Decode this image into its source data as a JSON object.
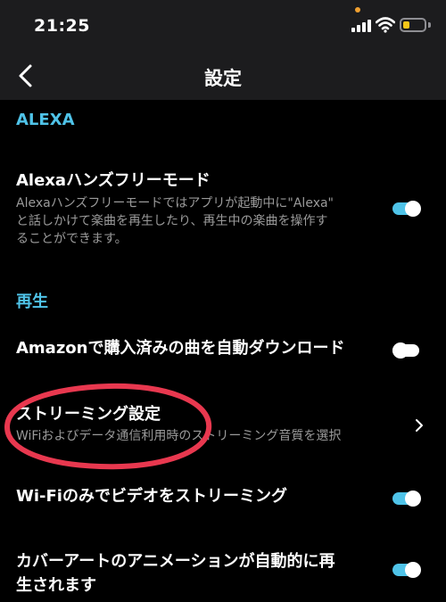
{
  "status_bar": {
    "time": "21:25",
    "icons": [
      "signal-icon",
      "wifi-icon",
      "battery-icon"
    ],
    "battery_level": 0.3
  },
  "nav": {
    "title": "設定",
    "back_icon": "chevron-left-icon"
  },
  "sections": {
    "alexa": {
      "header": "ALEXA",
      "handsfree": {
        "title": "Alexaハンズフリーモード",
        "subtitle_lines": [
          "Alexaハンズフリーモードではアプリが起動中に\"Alexa\"",
          "と話しかけて楽曲を再生したり、再生中の楽曲を操作す",
          "ることができます。"
        ],
        "enabled": true
      }
    },
    "playback": {
      "header": "再生",
      "auto_download": {
        "title": "Amazonで購入済みの曲を自動ダウンロード",
        "enabled": false
      },
      "streaming": {
        "title": "ストリーミング設定",
        "subtitle": "WiFiおよびデータ通信利用時のストリーミング音質を選択"
      },
      "wifi_video": {
        "title": "Wi-Fiのみでビデオをストリーミング",
        "enabled": true
      },
      "cover_art": {
        "title_lines": [
          "カバーアートのアニメーションが自動的に再",
          "生されます"
        ],
        "enabled": true
      }
    }
  },
  "colors": {
    "accent": "#4fc3e8",
    "highlight": "#e8384f",
    "background": "#000000",
    "bar_background": "#1c1c1e"
  }
}
